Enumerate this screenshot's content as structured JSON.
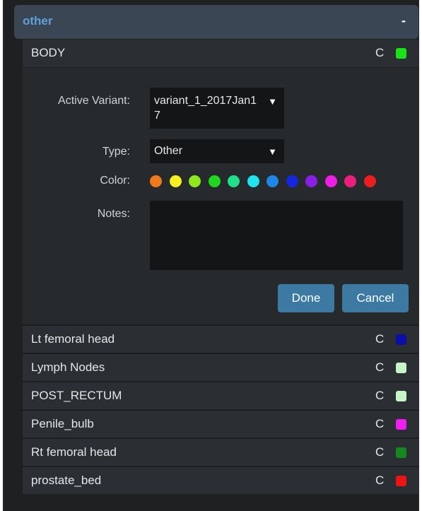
{
  "group": {
    "title": "other",
    "collapse_symbol": "-"
  },
  "selected_item": {
    "label": "BODY",
    "c_label": "C",
    "color": "#19e219"
  },
  "editor": {
    "active_variant_label": "Active Variant:",
    "active_variant_value": "variant_1_2017Jan17",
    "type_label": "Type:",
    "type_value": "Other",
    "color_label": "Color:",
    "notes_label": "Notes:",
    "notes_value": "",
    "palette": [
      "#f07a1b",
      "#f5f01e",
      "#8ee81e",
      "#1ed81e",
      "#1fe08a",
      "#1fe4ee",
      "#1e86e8",
      "#1426e0",
      "#8a1ee8",
      "#ee1ee6",
      "#ee1e7e",
      "#ee1e1e"
    ],
    "done_label": "Done",
    "cancel_label": "Cancel",
    "caret_icon": "▼"
  },
  "items": [
    {
      "label": "Lt femoral head",
      "c_label": "C",
      "color": "#0a0fa8"
    },
    {
      "label": "Lymph Nodes",
      "c_label": "C",
      "color": "#c8f5c8"
    },
    {
      "label": "POST_RECTUM",
      "c_label": "C",
      "color": "#c8f5c8"
    },
    {
      "label": "Penile_bulb",
      "c_label": "C",
      "color": "#f01ef0"
    },
    {
      "label": "Rt femoral head",
      "c_label": "C",
      "color": "#14871e"
    },
    {
      "label": "prostate_bed",
      "c_label": "C",
      "color": "#ee1414"
    }
  ]
}
